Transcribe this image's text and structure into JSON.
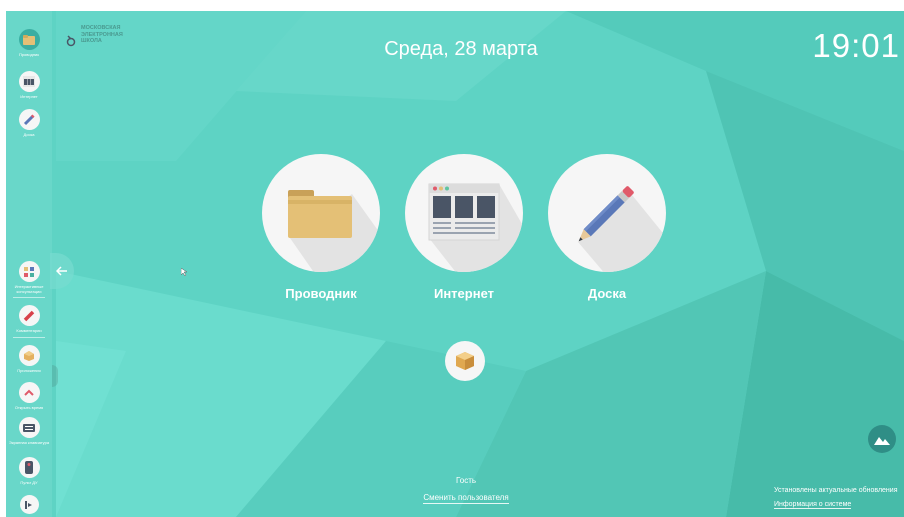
{
  "colors": {
    "background": "#5ed3c4",
    "sidebar": "#78dcd0",
    "tile_bg": "#f6f6f6",
    "white_text": "#ffffff",
    "folder": "#e4c076",
    "pencil_body": "#5a78b8",
    "pencil_eraser": "#e05a6a",
    "wallpaper_button": "#2f8e86"
  },
  "header": {
    "school_logo_text": [
      "МОСКОВСКАЯ",
      "ЭЛЕКТРОННАЯ",
      "ШКОЛА"
    ],
    "date": "Среда, 28 марта",
    "clock": "19:01"
  },
  "sidebar": {
    "top_items": [
      {
        "label": "Проводник",
        "icon": "folder-icon"
      },
      {
        "label": "Интернет",
        "icon": "browser-icon"
      },
      {
        "label": "Доска",
        "icon": "pencil-icon"
      }
    ],
    "bottom_items": [
      {
        "label": "Интерактивные консультации",
        "icon": "consultation-icon"
      },
      {
        "label": "Комментарии",
        "icon": "marker-icon"
      },
      {
        "label": "Приложения",
        "icon": "box-icon"
      },
      {
        "label": "Открыть время",
        "icon": "chevron-up-icon"
      },
      {
        "label": "Экранная клавиатура",
        "icon": "keyboard-icon"
      },
      {
        "label": "Пульт ДУ",
        "icon": "remote-icon"
      },
      {
        "label": "",
        "icon": "logout-icon"
      }
    ]
  },
  "apps": [
    {
      "label": "Проводник",
      "icon": "folder-icon"
    },
    {
      "label": "Интернет",
      "icon": "browser-icon"
    },
    {
      "label": "Доска",
      "icon": "pencil-icon"
    }
  ],
  "footer": {
    "user_name": "Гость",
    "switch_user": "Сменить пользователя",
    "updates_status": "Установлены актуальные обновления",
    "system_info": "Информация о системе"
  }
}
